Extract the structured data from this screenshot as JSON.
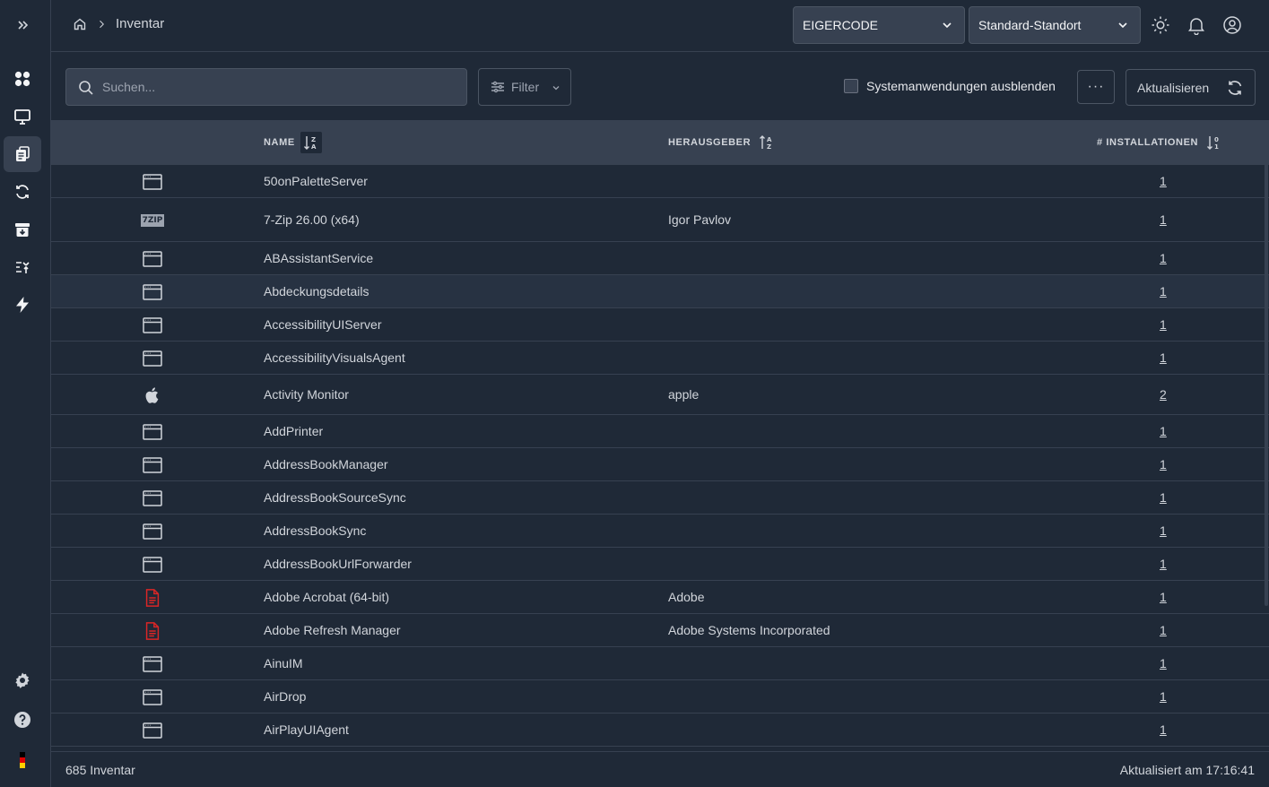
{
  "breadcrumb": {
    "page": "Inventar"
  },
  "header": {
    "tenant": "EIGERCODE",
    "location": "Standard-Standort"
  },
  "toolbar": {
    "search_placeholder": "Suchen...",
    "filter_label": "Filter",
    "hide_system_label": "Systemanwendungen ausblenden",
    "more_label": "···",
    "refresh_label": "Aktualisieren"
  },
  "table": {
    "columns": {
      "name": "NAME",
      "publisher": "HERAUSGEBER",
      "installs": "# INSTALLATIONEN"
    },
    "rows": [
      {
        "icon": "app-window-icon",
        "name": "50onPaletteServer",
        "publisher": "",
        "installs": "1"
      },
      {
        "icon": "7zip-logo-icon",
        "name": "7-Zip 26.00 (x64)",
        "publisher": "Igor Pavlov",
        "installs": "1"
      },
      {
        "icon": "app-window-icon",
        "name": "ABAssistantService",
        "publisher": "",
        "installs": "1"
      },
      {
        "icon": "app-window-icon",
        "name": "Abdeckungsdetails",
        "publisher": "",
        "installs": "1"
      },
      {
        "icon": "app-window-icon",
        "name": "AccessibilityUIServer",
        "publisher": "",
        "installs": "1"
      },
      {
        "icon": "app-window-icon",
        "name": "AccessibilityVisualsAgent",
        "publisher": "",
        "installs": "1"
      },
      {
        "icon": "apple-logo-icon",
        "name": "Activity Monitor",
        "publisher": "apple",
        "installs": "2"
      },
      {
        "icon": "app-window-icon",
        "name": "AddPrinter",
        "publisher": "",
        "installs": "1"
      },
      {
        "icon": "app-window-icon",
        "name": "AddressBookManager",
        "publisher": "",
        "installs": "1"
      },
      {
        "icon": "app-window-icon",
        "name": "AddressBookSourceSync",
        "publisher": "",
        "installs": "1"
      },
      {
        "icon": "app-window-icon",
        "name": "AddressBookSync",
        "publisher": "",
        "installs": "1"
      },
      {
        "icon": "app-window-icon",
        "name": "AddressBookUrlForwarder",
        "publisher": "",
        "installs": "1"
      },
      {
        "icon": "pdf-document-icon",
        "name": "Adobe Acrobat (64-bit)",
        "publisher": "Adobe",
        "installs": "1"
      },
      {
        "icon": "pdf-document-icon",
        "name": "Adobe Refresh Manager",
        "publisher": "Adobe Systems Incorporated",
        "installs": "1"
      },
      {
        "icon": "app-window-icon",
        "name": "AinuIM",
        "publisher": "",
        "installs": "1"
      },
      {
        "icon": "app-window-icon",
        "name": "AirDrop",
        "publisher": "",
        "installs": "1"
      },
      {
        "icon": "app-window-icon",
        "name": "AirPlayUIAgent",
        "publisher": "",
        "installs": "1"
      }
    ]
  },
  "footer": {
    "count": "685 Inventar",
    "updated": "Aktualisiert am 17:16:41"
  },
  "colors": {
    "background": "#1f2937",
    "header_row": "#374151",
    "pdf_red": "#dc2626"
  }
}
